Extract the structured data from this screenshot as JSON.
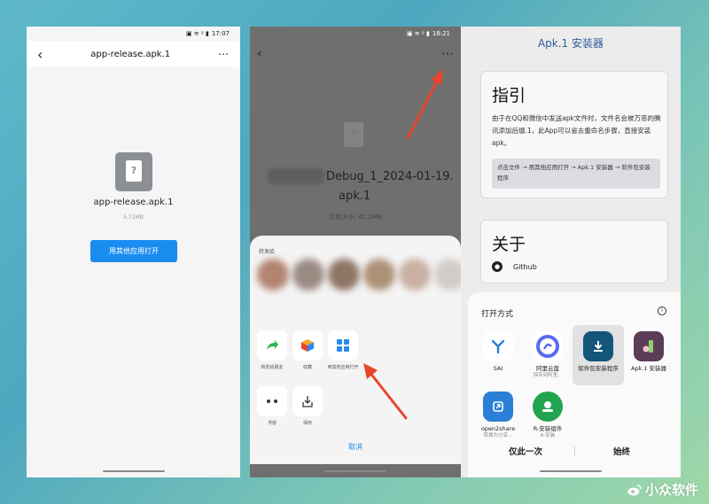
{
  "panel1": {
    "status_time": "17:07",
    "status_icons": "▣ ≋ ᵍ ▮",
    "title": "app-release.apk.1",
    "back_icon": "‹",
    "more_icon": "⋯",
    "file_icon_glyph": "?",
    "filename": "app-release.apk.1",
    "filesize": "5.72MB",
    "open_button": "用其他应用打开"
  },
  "panel2": {
    "status_time": "18:21",
    "status_icons": "▣ ≋ ᵍ ▮",
    "back_icon": "‹",
    "more_icon": "⋯",
    "file_icon_glyph": "?",
    "filename_line1": "Debug_1_2024-01-19.",
    "filename_line2": "apk.1",
    "filesize": "文件大小: 42.1MB",
    "share_title": "转发给",
    "actions": [
      {
        "label": "转发给朋友"
      },
      {
        "label": "收藏"
      },
      {
        "label": "用其他应用打开"
      },
      {
        "label": "浮窗"
      },
      {
        "label": "保存"
      }
    ],
    "cancel": "取消"
  },
  "panel3": {
    "app_title": "Apk.1 安装器",
    "guide_heading": "指引",
    "guide_text": "由于在QQ和微信中发送apk文件时，文件名会被万恶的腾讯添加后缀.1，此App可以省去重命名步骤，直接安装apk。",
    "guide_steps": "点击文件 → 用其他应用打开 → Apk.1 安装器 → 软件包安装程序",
    "about_heading": "关于",
    "github_label": "Github",
    "open_with_title": "打开方式",
    "apps": [
      {
        "name": "SAI",
        "sub": "",
        "icon": "sai-icon",
        "color": "#2a7fd6"
      },
      {
        "name": "阿里云盘",
        "sub": "保存到阿里...",
        "icon": "aliyun-drive-icon",
        "color": "#5a6cf0"
      },
      {
        "name": "软件包安装程序",
        "sub": "",
        "icon": "package-installer-icon",
        "color": "#14557a"
      },
      {
        "name": "Apk.1 安装器",
        "sub": "",
        "icon": "apk1-installer-icon",
        "color": "#5b3d58"
      },
      {
        "name": "open2share",
        "sub": "转换为分享...",
        "icon": "open2share-icon",
        "color": "#2a7fd6"
      },
      {
        "name": "R-安装组件",
        "sub": "R-安装",
        "icon": "r-install-icon",
        "color": "#21a34f"
      }
    ],
    "just_once": "仅此一次",
    "always": "始终"
  },
  "watermark": "小众软件",
  "colors": {
    "accent_blue": "#1a8cf0",
    "arrow_red": "#e8452c"
  }
}
